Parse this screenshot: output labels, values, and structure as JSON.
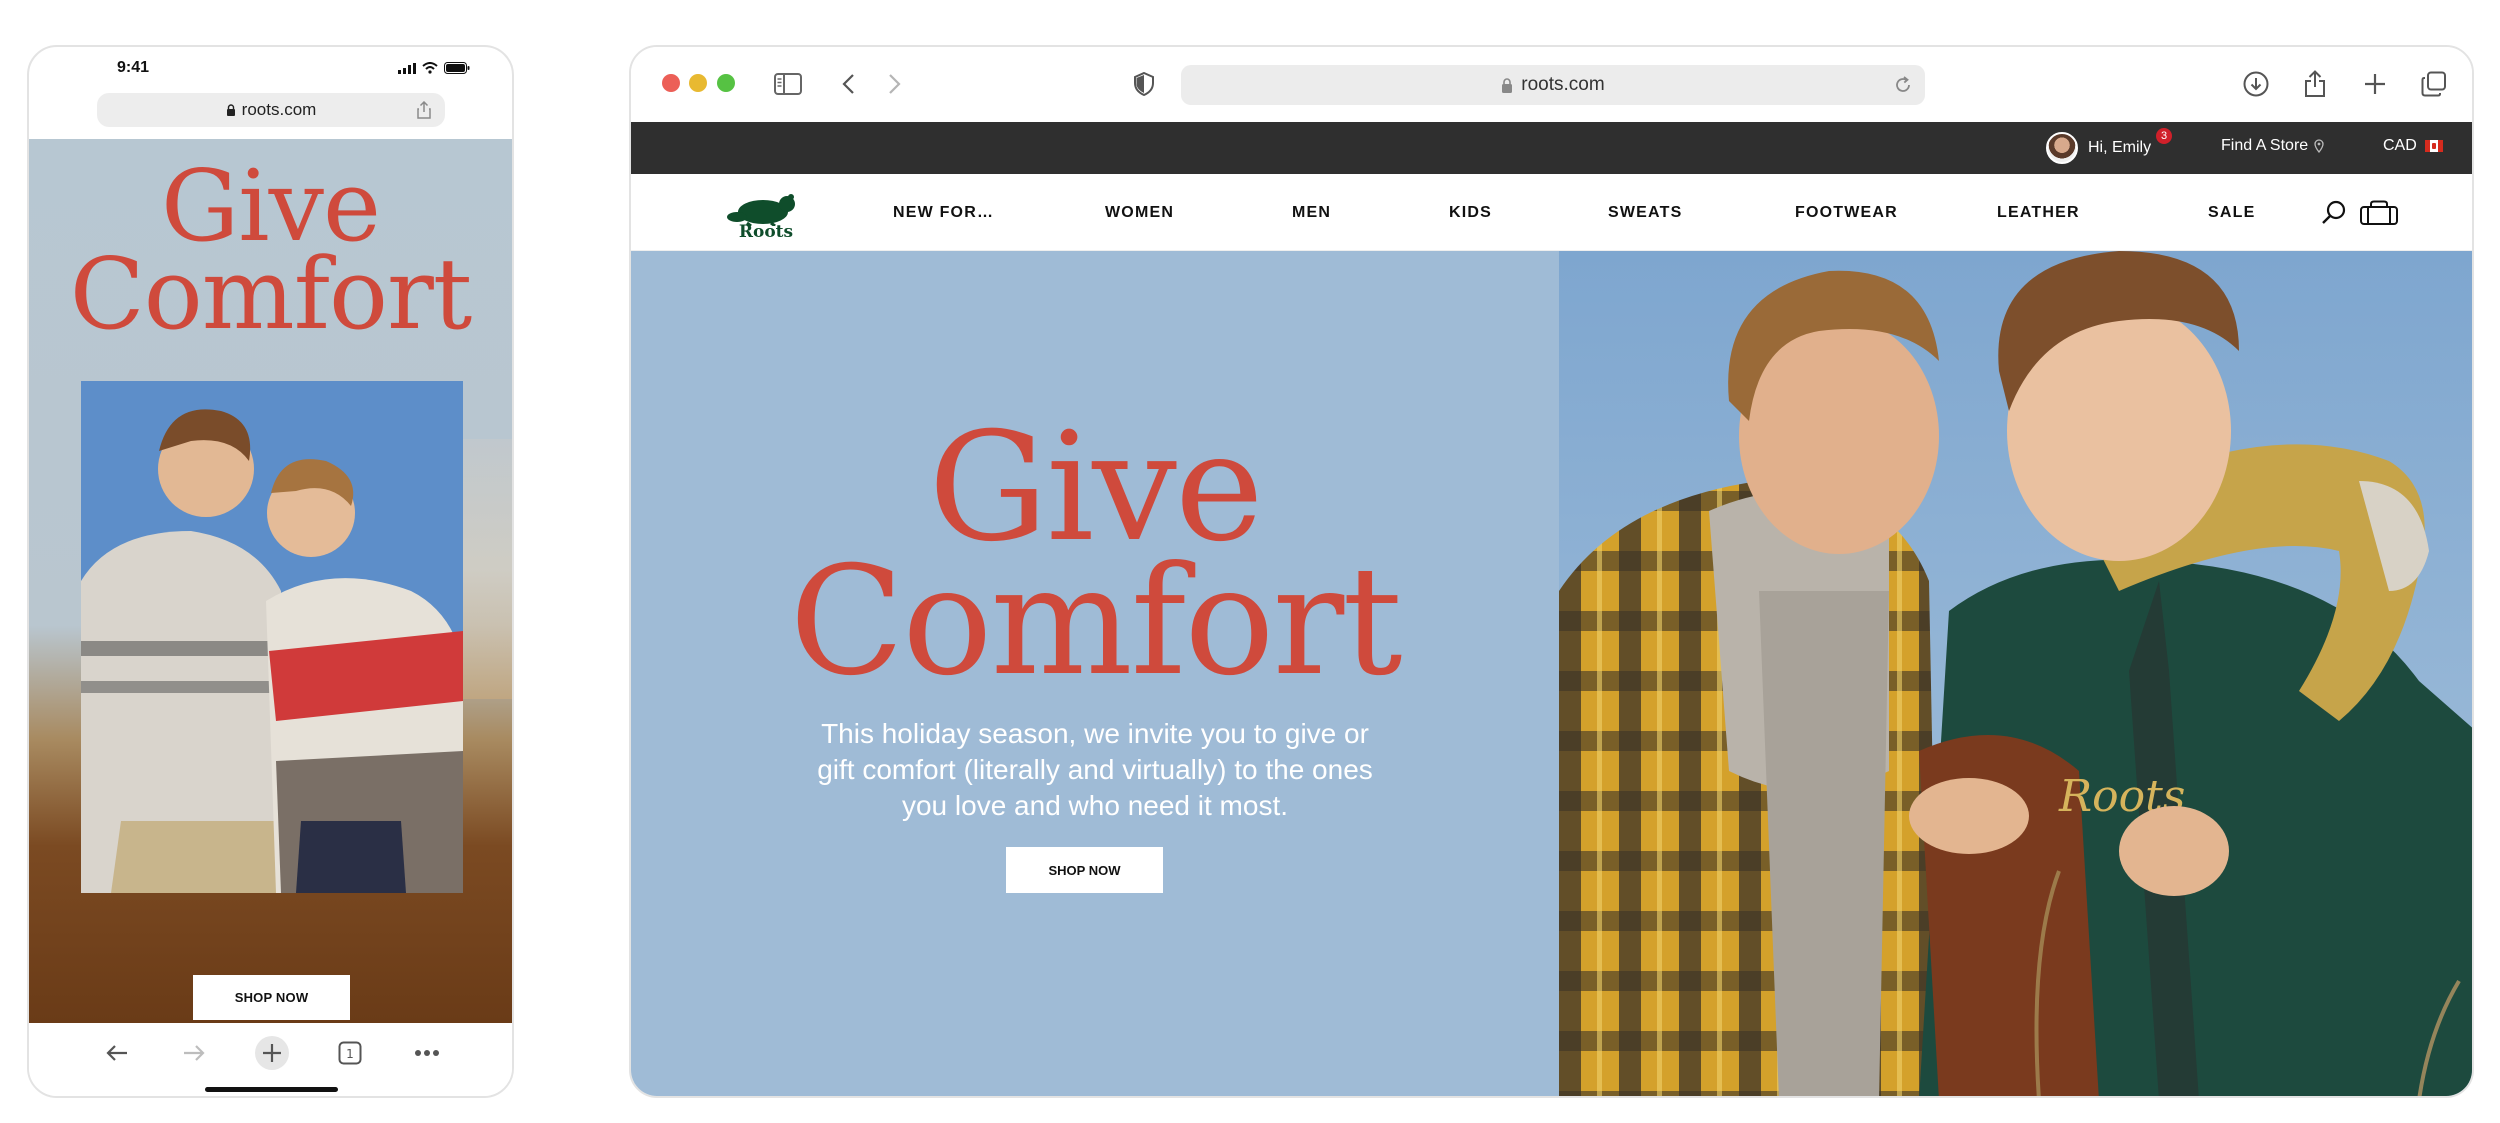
{
  "phone": {
    "time": "9:41",
    "url": "roots.com",
    "hero_title_line1": "Give",
    "hero_title_line2": "Comfort",
    "cta": "SHOP NOW",
    "tab_count": "1"
  },
  "browser": {
    "url": "roots.com",
    "utility": {
      "greeting": "Hi, Emily",
      "badge": "3",
      "store": "Find A Store",
      "currency": "CAD"
    },
    "logo": "Roots",
    "nav": [
      "NEW FOR…",
      "WOMEN",
      "MEN",
      "KIDS",
      "SWEATS",
      "FOOTWEAR",
      "LEATHER",
      "SALE"
    ],
    "hero": {
      "title_line1": "Give",
      "title_line2": "Comfort",
      "body": "This holiday season, we invite you to give or gift comfort (literally and virtually) to the ones you love and who need it most.",
      "cta": "SHOP NOW"
    }
  },
  "colors": {
    "title_red": "#cf4a3c",
    "hero_blue": "#9fbbd6",
    "utility_bar": "#2f2f2f",
    "logo_green": "#0f4d2b"
  },
  "icons": [
    "lock-icon",
    "share-icon",
    "back-icon",
    "forward-icon",
    "new-tab-icon",
    "tabs-icon",
    "more-icon",
    "sidebar-icon",
    "shield-icon",
    "reload-icon",
    "download-icon",
    "location-pin-icon",
    "search-icon",
    "bag-icon",
    "beaver-logo-icon"
  ]
}
